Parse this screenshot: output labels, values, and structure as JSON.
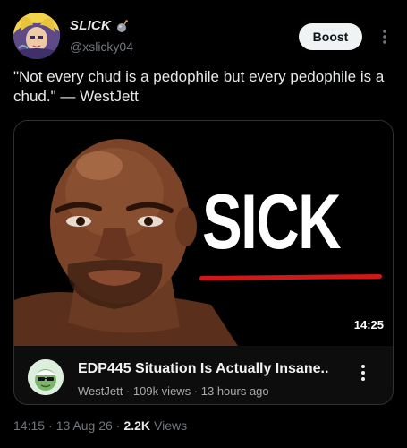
{
  "author": {
    "name": "SLICK",
    "handle": "@xslicky04",
    "badge_icon": "bomb-icon"
  },
  "actions": {
    "boost_label": "Boost"
  },
  "tweet": {
    "text": "\"Not every chud is a pedophile but every pedophile is a chud.\" — WestJett"
  },
  "video_card": {
    "thumbnail_text": "SICK",
    "duration": "14:25",
    "title": "EDP445 Situation Is Actually Insane..",
    "meta": "WestJett · 109k views · 13 hours ago"
  },
  "footer": {
    "time": "14:15",
    "sep1": "·",
    "date": "13 Aug 26",
    "sep2": "·",
    "views_count": "2.2K",
    "views_label": "Views"
  },
  "colors": {
    "background": "#000000",
    "text_primary": "#e7e9ea",
    "text_secondary": "#71767b",
    "accent_red": "#d01818"
  }
}
